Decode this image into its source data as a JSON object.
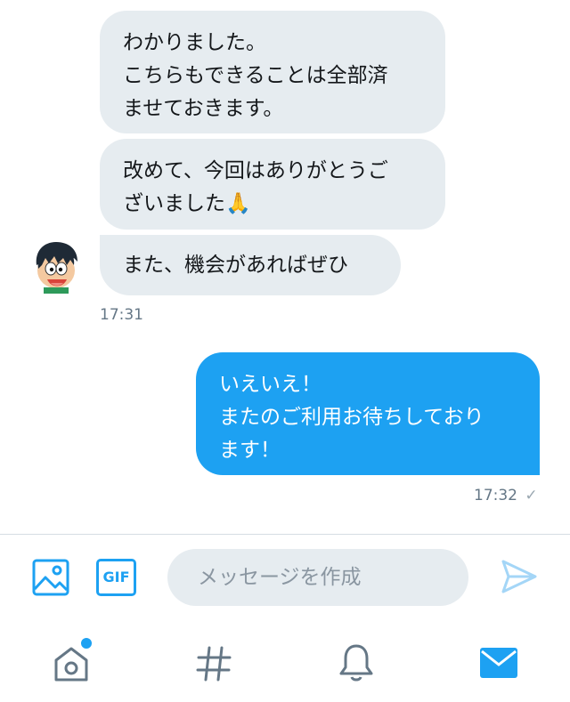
{
  "conversation": {
    "incoming": [
      {
        "text": "わかりました。\nこちらもできることは全部済\nませておきます。"
      },
      {
        "text": "改めて、今回はありがとうご\nざいました🙏"
      },
      {
        "text": "また、機会があればぜひ"
      }
    ],
    "incoming_timestamp": "17:31",
    "outgoing": [
      {
        "text": "いえいえ！\nまたのご利用お待ちしており\nます！"
      }
    ],
    "outgoing_timestamp": "17:32",
    "outgoing_status": "✓"
  },
  "composer": {
    "placeholder": "メッセージを作成",
    "gif_label": "GIF",
    "icons": [
      "image-icon",
      "gif-icon",
      "send-icon"
    ]
  },
  "bottom_nav": {
    "items": [
      "home-icon",
      "explore-hashtag-icon",
      "notifications-bell-icon",
      "messages-envelope-icon"
    ],
    "active": "messages-envelope-icon"
  },
  "colors": {
    "accent": "#1da1f2",
    "incoming_bubble": "#e6ecf0",
    "timestamp": "#657786"
  }
}
